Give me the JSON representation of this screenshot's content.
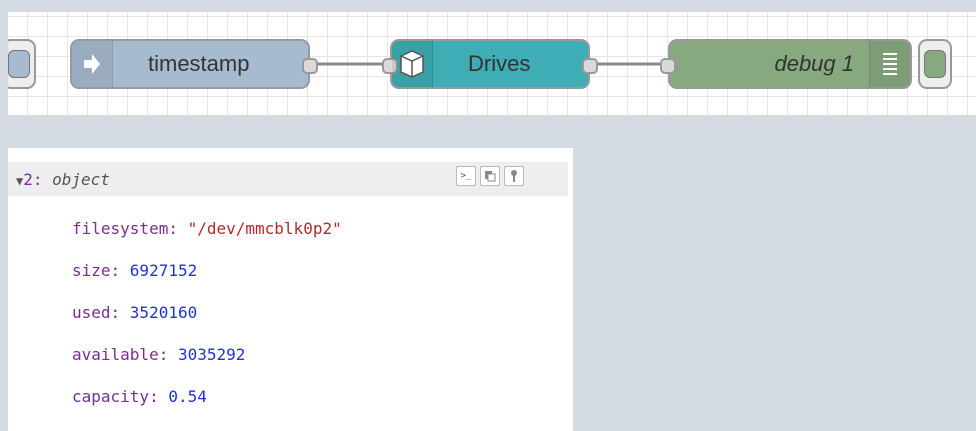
{
  "flow": {
    "nodes": {
      "inject": {
        "label": "timestamp",
        "color": "#a6bbcf"
      },
      "drives": {
        "label": "Drives",
        "color": "#3fadb5"
      },
      "debug": {
        "label": "debug 1",
        "color": "#87a980"
      }
    }
  },
  "debug_panel": {
    "item": {
      "index": "2",
      "type": "object"
    },
    "properties": [
      {
        "key": "filesystem",
        "value": "\"/dev/mmcblk0p2\"",
        "kind": "string"
      },
      {
        "key": "size",
        "value": "6927152",
        "kind": "number"
      },
      {
        "key": "used",
        "value": "3520160",
        "kind": "number"
      },
      {
        "key": "available",
        "value": "3035292",
        "kind": "number"
      },
      {
        "key": "capacity",
        "value": "0.54",
        "kind": "number"
      }
    ],
    "buttons": {
      "copy_path_icon": ">_",
      "copy_value_icon": "copy",
      "pin_icon": "pin"
    }
  }
}
